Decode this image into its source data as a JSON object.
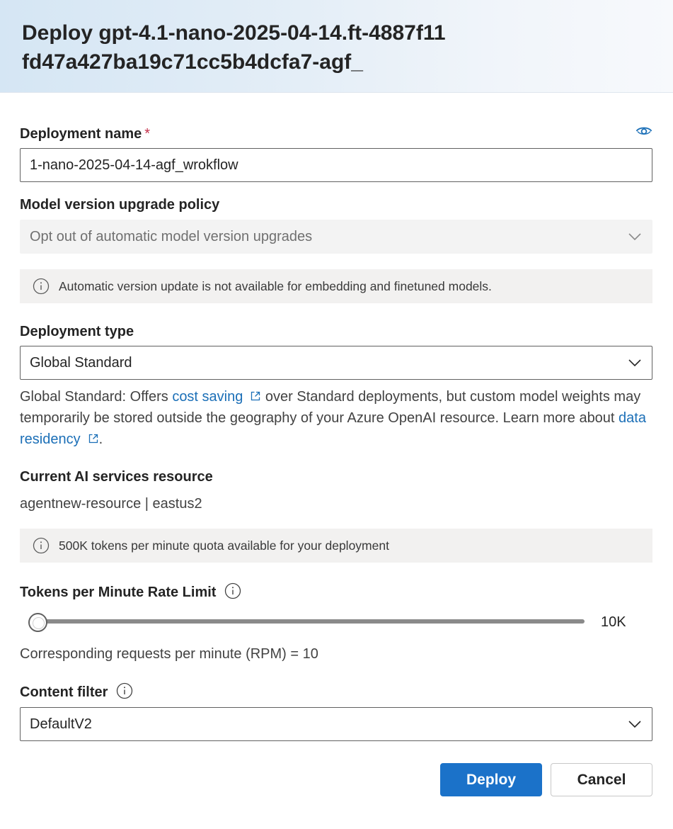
{
  "dialog": {
    "title": "Deploy gpt-4.1-nano-2025-04-14.ft-4887f11fd47a427ba19c71cc5b4dcfa7-agf_"
  },
  "deployment_name": {
    "label": "Deployment name",
    "required_mark": "*",
    "value": "1-nano-2025-04-14-agf_wrokflow"
  },
  "upgrade_policy": {
    "label": "Model version upgrade policy",
    "value": "Opt out of automatic model version upgrades",
    "info": "Automatic version update is not available for embedding and finetuned models."
  },
  "deployment_type": {
    "label": "Deployment type",
    "value": "Global Standard",
    "description_prefix": "Global Standard: Offers ",
    "link1": "cost saving",
    "description_middle": " over Standard deployments, but custom model weights may temporarily be stored outside the geography of your Azure OpenAI resource. Learn more about ",
    "link2": "data residency",
    "description_suffix": "."
  },
  "resource": {
    "label": "Current AI services resource",
    "value": "agentnew-resource | eastus2",
    "quota_info": "500K tokens per minute quota available for your deployment"
  },
  "rate_limit": {
    "label": "Tokens per Minute Rate Limit",
    "value_label": "10K",
    "slider_fraction": 0.0,
    "rpm_text": "Corresponding requests per minute (RPM) = 10"
  },
  "content_filter": {
    "label": "Content filter",
    "value": "DefaultV2"
  },
  "actions": {
    "deploy": "Deploy",
    "cancel": "Cancel"
  },
  "colors": {
    "accent": "#1b72c9",
    "link": "#1b6fb7",
    "required": "#c4314b"
  }
}
